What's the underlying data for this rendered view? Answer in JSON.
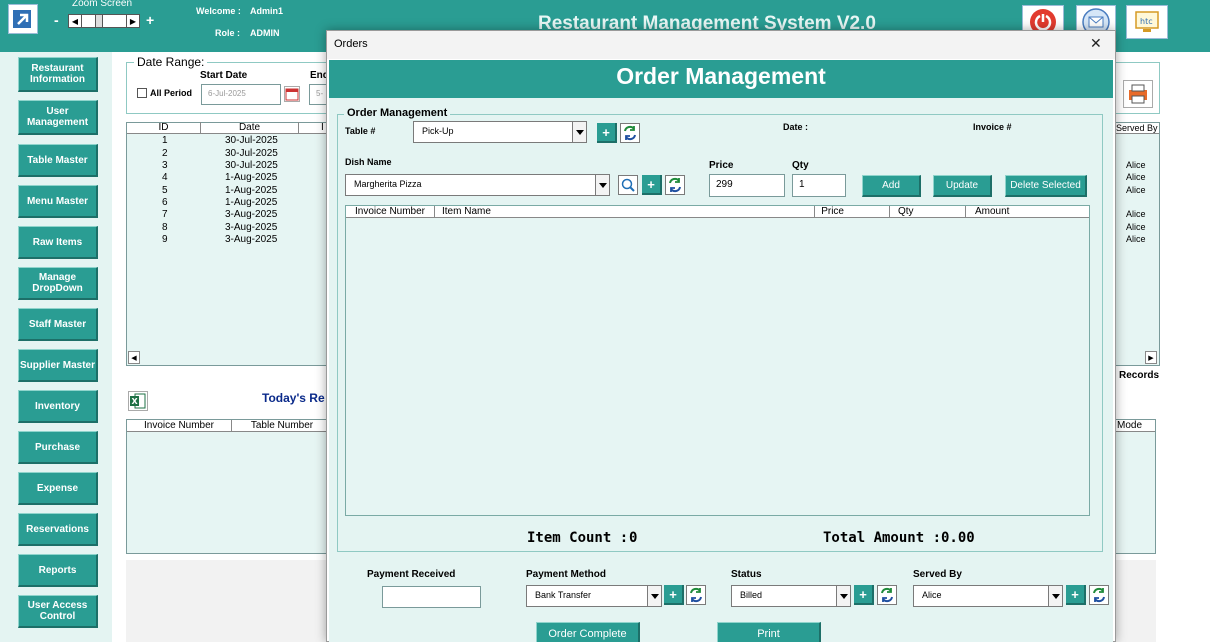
{
  "header": {
    "zoom_label": "Zoom Screen",
    "zoom_minus": "-",
    "zoom_plus": "+",
    "welcome_label": "Welcome :",
    "welcome_value": "Admin1",
    "role_label": "Role :",
    "role_value": "ADMIN",
    "title": "Restaurant Management System V2.0"
  },
  "sidebar": {
    "items": [
      {
        "label": "Restaurant Information"
      },
      {
        "label": "User Management"
      },
      {
        "label": "Table Master"
      },
      {
        "label": "Menu Master"
      },
      {
        "label": "Raw Items"
      },
      {
        "label": "Manage DropDown"
      },
      {
        "label": "Staff Master"
      },
      {
        "label": "Supplier Master"
      },
      {
        "label": "Inventory"
      },
      {
        "label": "Purchase"
      },
      {
        "label": "Expense"
      },
      {
        "label": "Reservations"
      },
      {
        "label": "Reports"
      },
      {
        "label": "User Access Control"
      }
    ]
  },
  "background": {
    "date_range_label": "Date Range:",
    "start_date_label": "Start Date",
    "end_date_label_partial": "End",
    "all_period_label": "All Period",
    "start_date_value": "6-Jul-2025",
    "end_date_partial": "5-",
    "columns": [
      "ID",
      "Date",
      "I"
    ],
    "served_by_header": "Served By",
    "rows": [
      {
        "id": "1",
        "date": "30-Jul-2025",
        "served": ""
      },
      {
        "id": "2",
        "date": "30-Jul-2025",
        "served": "Alice"
      },
      {
        "id": "3",
        "date": "30-Jul-2025",
        "served": "Alice"
      },
      {
        "id": "4",
        "date": "1-Aug-2025",
        "served": "Alice"
      },
      {
        "id": "5",
        "date": "1-Aug-2025",
        "served": ""
      },
      {
        "id": "6",
        "date": "1-Aug-2025",
        "served": "Alice"
      },
      {
        "id": "7",
        "date": "3-Aug-2025",
        "served": "Alice"
      },
      {
        "id": "8",
        "date": "3-Aug-2025",
        "served": "Alice"
      },
      {
        "id": "9",
        "date": "3-Aug-2025",
        "served": ""
      }
    ],
    "records_label": "Records",
    "todays_label": "Today's Re",
    "lower_columns": [
      "Invoice Number",
      "Table Number"
    ],
    "mode_header": "Mode"
  },
  "dialog": {
    "window_title": "Orders",
    "close_glyph": "✕",
    "banner": "Order Management",
    "group_label": "Order Management",
    "table_label": "Table #",
    "table_value": "Pick-Up",
    "date_label": "Date :",
    "invoice_label": "Invoice #",
    "dish_label": "Dish Name",
    "dish_value": "Margherita Pizza",
    "price_label": "Price",
    "price_value": "299",
    "qty_label": "Qty",
    "qty_value": "1",
    "add_label": "Add",
    "update_label": "Update",
    "delete_label": "Delete Selected",
    "grid_columns": [
      "Invoice Number",
      "Item Name",
      "Price",
      "Qty",
      "Amount"
    ],
    "item_count_label": "Item Count :",
    "item_count_value": "0",
    "total_amount_label": "Total Amount :",
    "total_amount_value": "0.00",
    "payment_received_label": "Payment Received",
    "payment_received_value": "",
    "payment_method_label": "Payment Method",
    "payment_method_value": "Bank Transfer",
    "status_label": "Status",
    "status_value": "Billed",
    "served_by_label": "Served By",
    "served_by_value": "Alice",
    "order_complete_label": "Order Complete",
    "print_label": "Print"
  },
  "colors": {
    "teal": "#2a9d93",
    "panel": "#e4f4f2",
    "grid": "#e6f5f3"
  }
}
